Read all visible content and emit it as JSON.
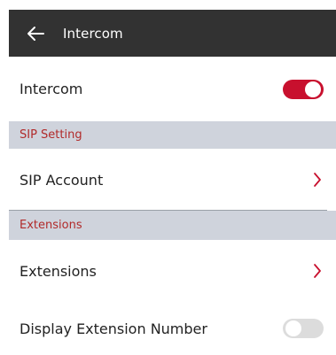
{
  "header": {
    "title": "Intercom",
    "back_icon": "arrow-left-icon"
  },
  "rows": {
    "intercom": {
      "label": "Intercom",
      "toggle_on": true
    },
    "sip_account": {
      "label": "SIP Account",
      "icon": "chevron-right-icon"
    },
    "extensions": {
      "label": "Extensions",
      "icon": "chevron-right-icon"
    },
    "display_extension_number": {
      "label": "Display Extension Number",
      "toggle_on": false
    }
  },
  "sections": {
    "sip_setting": "SIP Setting",
    "extensions": "Extensions"
  },
  "colors": {
    "accent": "#c8102e",
    "section_bg": "#cfd3dc",
    "section_text": "#b12a2a",
    "header_bg": "#323232"
  }
}
